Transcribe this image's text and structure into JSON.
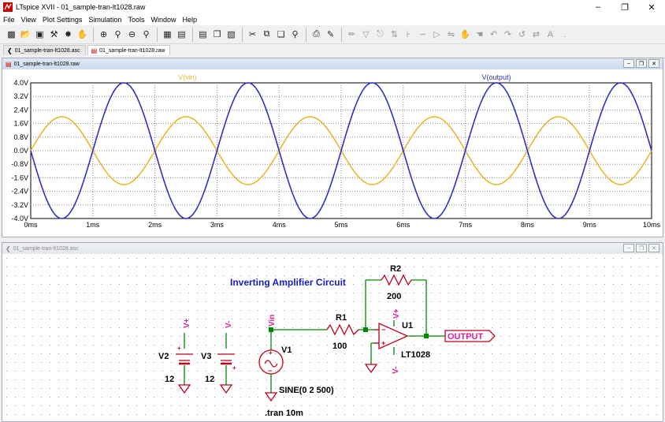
{
  "window": {
    "title": "LTspice XVII - 01_sample-tran-lt1028.raw"
  },
  "menu": [
    "File",
    "View",
    "Plot Settings",
    "Simulation",
    "Tools",
    "Window",
    "Help"
  ],
  "tabs": [
    {
      "label": "01_sample-tran-lt1028.asc",
      "active": false
    },
    {
      "label": "01_sample-tran-lt1028.raw",
      "active": true
    }
  ],
  "plot": {
    "window_title": "01_sample-tran-lt1028.raw",
    "colors": {
      "vin": "#e8b830",
      "output": "#3030c8",
      "grid": "#888888"
    }
  },
  "chart_data": {
    "type": "line",
    "xlabel": "",
    "ylabel": "",
    "x_ticks": [
      "0ms",
      "1ms",
      "2ms",
      "3ms",
      "4ms",
      "5ms",
      "6ms",
      "7ms",
      "8ms",
      "9ms",
      "10ms"
    ],
    "y_ticks": [
      "4.0V",
      "3.2V",
      "2.4V",
      "1.6V",
      "0.8V",
      "0.0V",
      "-0.8V",
      "-1.6V",
      "-2.4V",
      "-3.2V",
      "-4.0V"
    ],
    "xlim": [
      0,
      10
    ],
    "ylim": [
      -4,
      4
    ],
    "grid": true,
    "series": [
      {
        "name": "V(vin)",
        "amplitude": 2,
        "frequency_khz": 0.5,
        "offset": 0,
        "phase_sign": 1
      },
      {
        "name": "V(output)",
        "amplitude": 4,
        "frequency_khz": 0.5,
        "offset": 0,
        "phase_sign": -1
      }
    ]
  },
  "schematic": {
    "window_title": "01_sample-tran-lt1028.asc",
    "title": "Inverting Amplifier Circuit",
    "r1": {
      "name": "R1",
      "value": "100"
    },
    "r2": {
      "name": "R2",
      "value": "200"
    },
    "v1": {
      "name": "V1",
      "value": "SINE(0 2 500)"
    },
    "v2": {
      "name": "V2",
      "value": "12"
    },
    "v3": {
      "name": "V3",
      "value": "12"
    },
    "u1": {
      "name": "U1",
      "model": "LT1028"
    },
    "labels": {
      "vin": "Vin",
      "vplus": "V+",
      "vminus": "V-",
      "output": "OUTPUT"
    },
    "directive": ".tran 10m"
  }
}
